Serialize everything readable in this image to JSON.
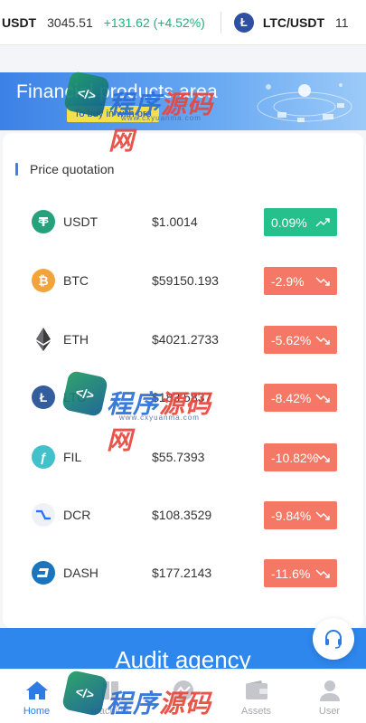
{
  "ticker": {
    "item1": {
      "symbol": "USDT",
      "price": "3045.51",
      "change": "+131.62 (+4.52%)"
    },
    "item2": {
      "symbol": "LTC/USDT",
      "price": "11"
    }
  },
  "banner": {
    "title": "Financial products area",
    "subtitle": "To buy in with pro"
  },
  "quotes": {
    "title": "Price quotation",
    "rows": [
      {
        "name": "USDT",
        "price": "$1.0014",
        "change": "0.09%",
        "direction": "up",
        "icon": "usdt-icon",
        "color": "#26a17b"
      },
      {
        "name": "BTC",
        "price": "$59150.193",
        "change": "-2.9%",
        "direction": "down",
        "icon": "btc-icon",
        "color": "#f2a33a"
      },
      {
        "name": "ETH",
        "price": "$4021.2733",
        "change": "-5.62%",
        "direction": "down",
        "icon": "eth-icon",
        "color": "#3c3c3d"
      },
      {
        "name": "LTC",
        "price": "$183.5837",
        "change": "-8.42%",
        "direction": "down",
        "icon": "ltc-icon",
        "color": "#345d9d"
      },
      {
        "name": "FIL",
        "price": "$55.7393",
        "change": "-10.82%",
        "direction": "down",
        "icon": "fil-icon",
        "color": "#42c1ca"
      },
      {
        "name": "DCR",
        "price": "$108.3529",
        "change": "-9.84%",
        "direction": "down",
        "icon": "dcr-icon",
        "color": "#2ed6a1"
      },
      {
        "name": "DASH",
        "price": "$177.2143",
        "change": "-11.6%",
        "direction": "down",
        "icon": "dash-icon",
        "color": "#1c75bc"
      }
    ]
  },
  "audit": {
    "title": "Audit agency"
  },
  "nav": {
    "items": [
      {
        "label": "Home",
        "icon": "home-icon",
        "active": true
      },
      {
        "label": "machine",
        "icon": "machine-icon",
        "active": false
      },
      {
        "label": "",
        "icon": "market-icon",
        "active": false
      },
      {
        "label": "Assets",
        "icon": "wallet-icon",
        "active": false
      },
      {
        "label": "User",
        "icon": "user-icon",
        "active": false
      }
    ]
  },
  "watermark": {
    "text_a": "程序",
    "text_b": "源码网",
    "url": "www.cxyuanma.com"
  },
  "colors": {
    "up": "#26c08d",
    "down": "#f47865",
    "accent": "#2e7be3"
  }
}
